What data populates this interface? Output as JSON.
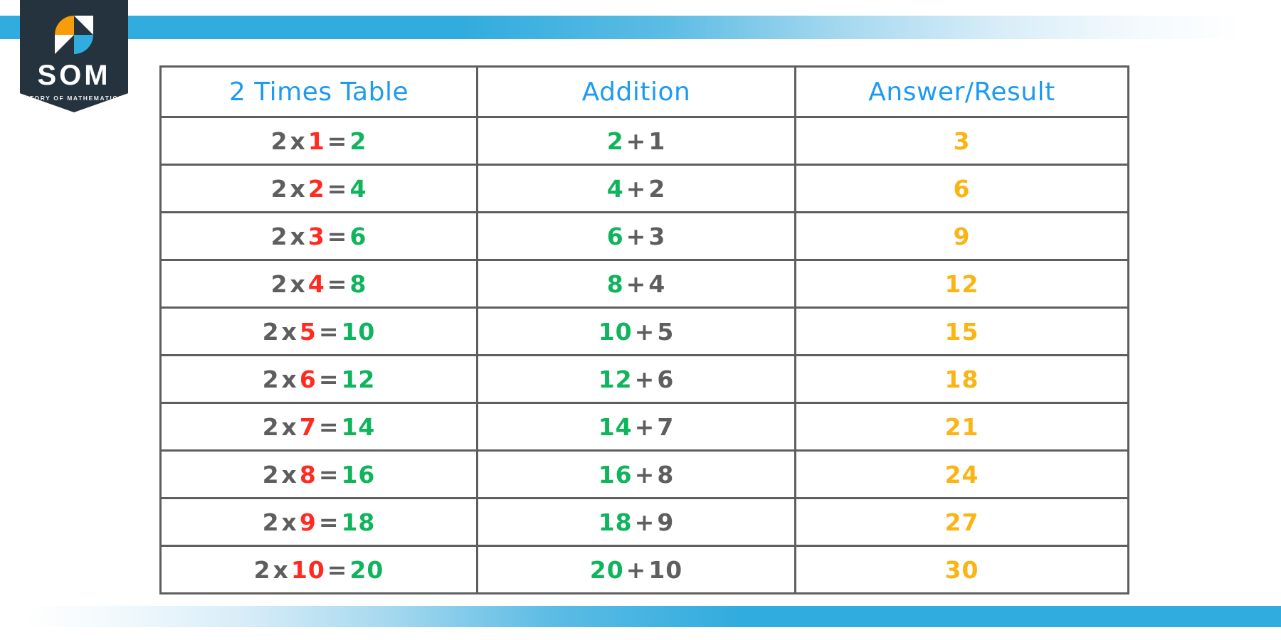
{
  "logo": {
    "name": "SOM",
    "tagline": "STORY OF MATHEMATICS",
    "mark_icon": "som-s-mark-icon",
    "colors": {
      "banner": "#24333D",
      "orange": "#F79C0A",
      "blue": "#31ACDE",
      "white": "#FFFFFF"
    }
  },
  "decor": {
    "top_band_color": "#31ACDE",
    "bottom_band_color": "#31ACDE"
  },
  "table": {
    "headers": [
      "2 Times Table",
      "Addition",
      "Answer/Result"
    ],
    "header_color": "#1E9BF0",
    "border_color": "#5E5E5E",
    "colors": {
      "base": "#5E5E5E",
      "multiplier": "#FF2B21",
      "product": "#0FB45C",
      "answer": "#FAB413"
    },
    "symbols": {
      "times": "x",
      "equals": "=",
      "plus": "+"
    },
    "base_factor": "2",
    "rows": [
      {
        "multiplier": "1",
        "product": "2",
        "addend": "1",
        "answer": "3"
      },
      {
        "multiplier": "2",
        "product": "4",
        "addend": "2",
        "answer": "6"
      },
      {
        "multiplier": "3",
        "product": "6",
        "addend": "3",
        "answer": "9"
      },
      {
        "multiplier": "4",
        "product": "8",
        "addend": "4",
        "answer": "12"
      },
      {
        "multiplier": "5",
        "product": "10",
        "addend": "5",
        "answer": "15"
      },
      {
        "multiplier": "6",
        "product": "12",
        "addend": "6",
        "answer": "18"
      },
      {
        "multiplier": "7",
        "product": "14",
        "addend": "7",
        "answer": "21"
      },
      {
        "multiplier": "8",
        "product": "16",
        "addend": "8",
        "answer": "24"
      },
      {
        "multiplier": "9",
        "product": "18",
        "addend": "9",
        "answer": "27"
      },
      {
        "multiplier": "10",
        "product": "20",
        "addend": "10",
        "answer": "30"
      }
    ]
  }
}
